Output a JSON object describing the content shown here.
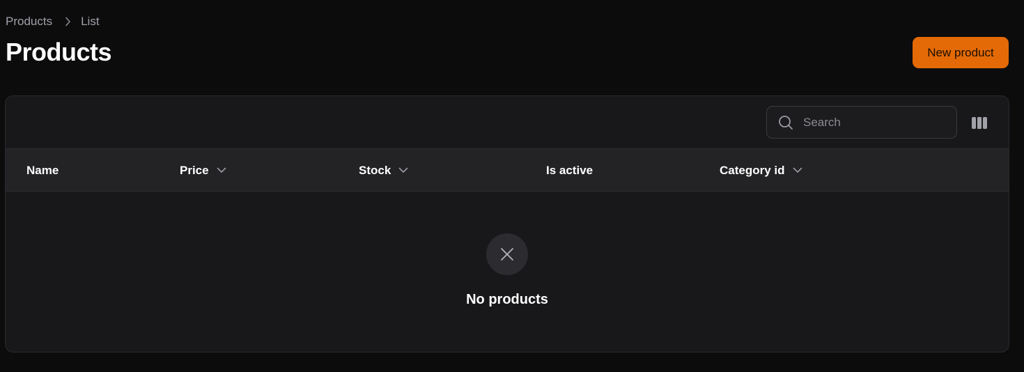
{
  "breadcrumb": {
    "items": [
      "Products",
      "List"
    ]
  },
  "page": {
    "title": "Products"
  },
  "actions": {
    "new_label": "New product",
    "accent_color": "#e36a06"
  },
  "table": {
    "search": {
      "placeholder": "Search",
      "value": ""
    },
    "columns": [
      {
        "label": "Name",
        "sortable": false
      },
      {
        "label": "Price",
        "sortable": true
      },
      {
        "label": "Stock",
        "sortable": true
      },
      {
        "label": "Is active",
        "sortable": false
      },
      {
        "label": "Category id",
        "sortable": true
      }
    ],
    "rows": [],
    "empty_state": {
      "icon": "x-icon",
      "message": "No products"
    }
  },
  "icons": {
    "breadcrumb_separator": "chevron-right-icon",
    "search": "search-icon",
    "columns_toggle": "columns-icon",
    "sort": "chevron-down-icon"
  }
}
